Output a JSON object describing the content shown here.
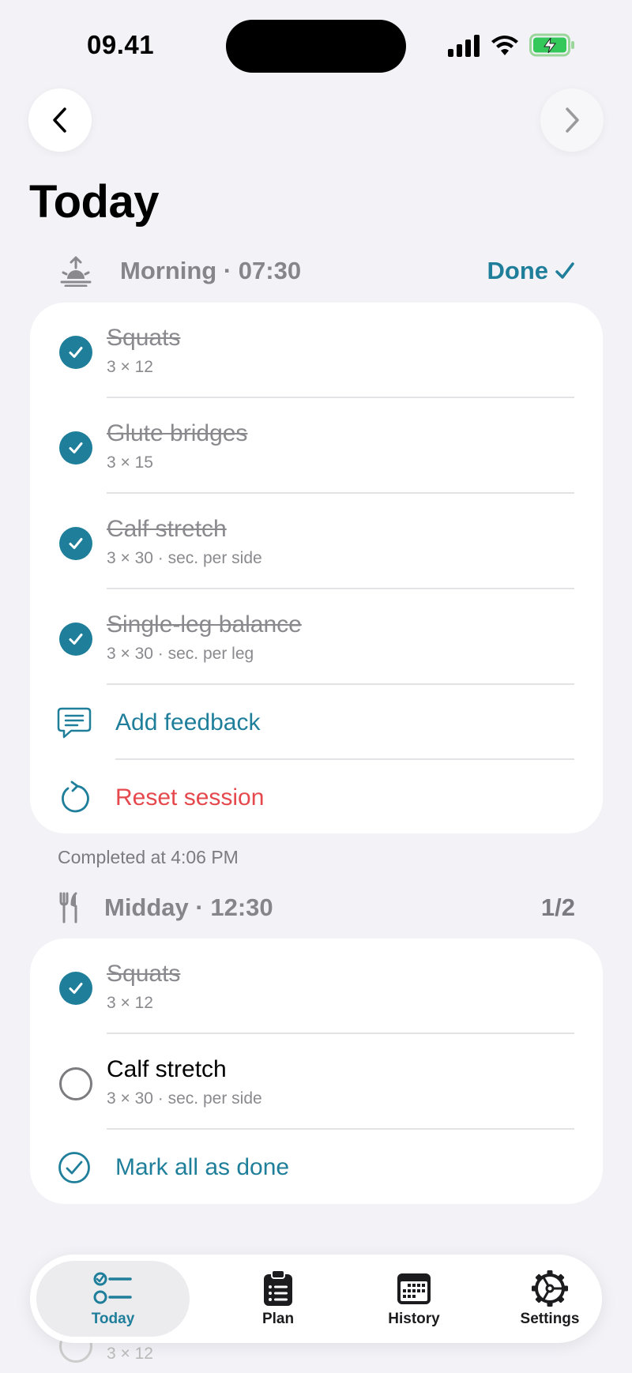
{
  "status_bar": {
    "time": "09.41"
  },
  "page": {
    "title": "Today"
  },
  "sections": {
    "morning": {
      "title": "Morning · 07:30",
      "status": "Done",
      "exercises": [
        {
          "name": "Squats",
          "detail": "3 × 12",
          "done": true
        },
        {
          "name": "Glute bridges",
          "detail": "3 × 15",
          "done": true
        },
        {
          "name": "Calf stretch",
          "detail": "3 × 30 · sec. per side",
          "done": true
        },
        {
          "name": "Single-leg balance",
          "detail": "3 × 30 · sec. per leg",
          "done": true
        }
      ],
      "add_feedback": "Add feedback",
      "reset_session": "Reset session",
      "completed_note": "Completed at 4:06 PM"
    },
    "midday": {
      "title": "Midday · 12:30",
      "progress": "1/2",
      "exercises": [
        {
          "name": "Squats",
          "detail": "3 × 12",
          "done": true
        },
        {
          "name": "Calf stretch",
          "detail": "3 × 30 · sec. per side",
          "done": false
        }
      ],
      "mark_all": "Mark all as done"
    },
    "evening": {
      "peek_detail": "3 × 12"
    }
  },
  "tabs": [
    {
      "label": "Today",
      "icon": "checklist-icon",
      "active": true
    },
    {
      "label": "Plan",
      "icon": "clipboard-icon",
      "active": false
    },
    {
      "label": "History",
      "icon": "calendar-icon",
      "active": false
    },
    {
      "label": "Settings",
      "icon": "gear-icon",
      "active": false
    }
  ],
  "colors": {
    "accent": "#1f7f9b",
    "destructive": "#e5484d",
    "background": "#f2f2f7"
  }
}
